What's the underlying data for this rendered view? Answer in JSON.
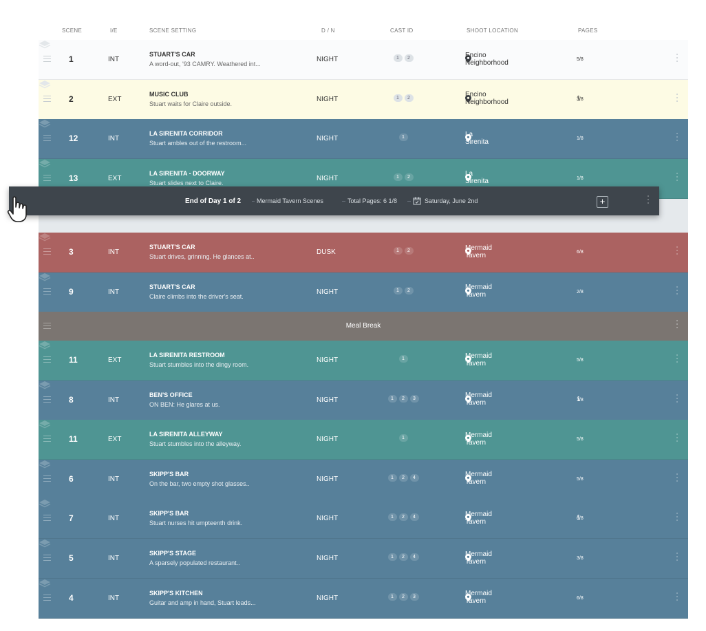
{
  "columns": {
    "scene": "SCENE",
    "ie": "I/E",
    "setting": "SCENE SETTING",
    "dn": "D / N",
    "cast": "CAST ID",
    "location": "SHOOT LOCATION",
    "pages": "PAGES"
  },
  "colors": {
    "white": "#fafbfc",
    "yellow": "#fdfbe4",
    "blue": "#57809a",
    "teal": "#4f9593",
    "red": "#ab6261",
    "meal": "#7b7571",
    "band": "#3e454c"
  },
  "rows_top": [
    {
      "scene": "1",
      "ie": "INT",
      "title": "STUART'S CAR",
      "desc": "A word-out, '93 CAMRY. Weathered int...",
      "dn": "NIGHT",
      "cast": [
        "1",
        "2"
      ],
      "location": "Encino Neighborhood",
      "pages_whole": "",
      "pages_frac": "5/8",
      "color": "white"
    },
    {
      "scene": "2",
      "ie": "EXT",
      "title": "MUSIC CLUB",
      "desc": "Stuart waits for Claire outside.",
      "dn": "NIGHT",
      "cast": [
        "1",
        "2"
      ],
      "location": "Encino Neighborhood",
      "pages_whole": "1",
      "pages_frac": "3/8",
      "color": "yellow"
    },
    {
      "scene": "12",
      "ie": "INT",
      "title": "LA SIRENITA CORRIDOR",
      "desc": "Stuart ambles out of the restroom...",
      "dn": "NIGHT",
      "cast": [
        "1"
      ],
      "location": "La Sirenita",
      "pages_whole": "",
      "pages_frac": "1/8",
      "color": "blue"
    },
    {
      "scene": "13",
      "ie": "EXT",
      "title": "LA SIRENITA - DOORWAY",
      "desc": "Stuart slides next to Claire.",
      "dn": "NIGHT",
      "cast": [
        "1",
        "2"
      ],
      "location": "La Sirenita",
      "pages_whole": "",
      "pages_frac": "1/8",
      "color": "teal"
    }
  ],
  "day_band": {
    "end_of_day": "End of Day 1 of 2",
    "description": "Mermaid Tavern Scenes",
    "total_pages": "Total Pages: 6 1/8",
    "date": "Saturday, June 2nd",
    "add_label": "+"
  },
  "rows_bottom_a": [
    {
      "scene": "3",
      "ie": "INT",
      "title": "STUART'S CAR",
      "desc": "Stuart drives, grinning. He glances at..",
      "dn": "DUSK",
      "cast": [
        "1",
        "2"
      ],
      "location": "Mermaid Tavern",
      "pages_whole": "",
      "pages_frac": "6/8",
      "color": "red"
    },
    {
      "scene": "9",
      "ie": "INT",
      "title": "STUART'S CAR",
      "desc": "Claire climbs into the driver's seat.",
      "dn": "NIGHT",
      "cast": [
        "1",
        "2"
      ],
      "location": "Mermaid Tavern",
      "pages_whole": "",
      "pages_frac": "2/8",
      "color": "blue"
    }
  ],
  "meal_break": "Meal Break",
  "rows_bottom_b": [
    {
      "scene": "11",
      "ie": "EXT",
      "title": "LA SIRENITA RESTROOM",
      "desc": "Stuart stumbles into the dingy room.",
      "dn": "NIGHT",
      "cast": [
        "1"
      ],
      "location": "Mermaid Tavern",
      "pages_whole": "",
      "pages_frac": "5/8",
      "color": "teal"
    },
    {
      "scene": "8",
      "ie": "INT",
      "title": "BEN'S OFFICE",
      "desc": "ON BEN: He glares at us.",
      "dn": "NIGHT",
      "cast": [
        "1",
        "2",
        "3"
      ],
      "location": "Mermaid Tavern",
      "pages_whole": "1",
      "pages_frac": "1/8",
      "color": "blue"
    },
    {
      "scene": "11",
      "ie": "EXT",
      "title": "LA SIRENITA ALLEYWAY",
      "desc": "Stuart stumbles into the alleyway.",
      "dn": "NIGHT",
      "cast": [
        "1"
      ],
      "location": "Mermaid Tavern",
      "pages_whole": "",
      "pages_frac": "5/8",
      "color": "teal"
    },
    {
      "scene": "6",
      "ie": "INT",
      "title": "SKIPP'S BAR",
      "desc": "On the bar, two empty shot glasses..",
      "dn": "NIGHT",
      "cast": [
        "1",
        "2",
        "4"
      ],
      "location": "Mermaid Tavern",
      "pages_whole": "",
      "pages_frac": "5/8",
      "color": "blue"
    },
    {
      "scene": "7",
      "ie": "INT",
      "title": "SKIPP'S BAR",
      "desc": "Stuart nurses hit umpteenth drink.",
      "dn": "NIGHT",
      "cast": [
        "1",
        "2",
        "4"
      ],
      "location": "Mermaid Tavern",
      "pages_whole": "1",
      "pages_frac": "6/8",
      "color": "blue"
    },
    {
      "scene": "5",
      "ie": "INT",
      "title": "SKIPP'S STAGE",
      "desc": "A sparsely populated restaurant..",
      "dn": "NIGHT",
      "cast": [
        "1",
        "2",
        "4"
      ],
      "location": "Mermaid Tavern",
      "pages_whole": "",
      "pages_frac": "3/8",
      "color": "blue"
    },
    {
      "scene": "4",
      "ie": "INT",
      "title": "SKIPP'S KITCHEN",
      "desc": "Guitar and amp in hand, Stuart leads...",
      "dn": "NIGHT",
      "cast": [
        "1",
        "2",
        "3"
      ],
      "location": "Mermaid Tavern",
      "pages_whole": "",
      "pages_frac": "6/8",
      "color": "blue"
    }
  ]
}
